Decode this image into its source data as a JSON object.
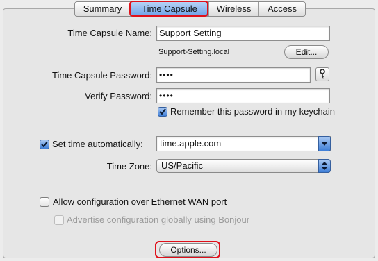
{
  "tabs": [
    {
      "label": "Summary",
      "active": false
    },
    {
      "label": "Time Capsule",
      "active": true
    },
    {
      "label": "Wireless",
      "active": false
    },
    {
      "label": "Access",
      "active": false
    }
  ],
  "form": {
    "name_label": "Time Capsule Name:",
    "name_value": "Support Setting",
    "local_hostname": "Support-Setting.local",
    "edit_button": "Edit...",
    "password_label": "Time Capsule Password:",
    "password_value": "••••",
    "verify_label": "Verify Password:",
    "verify_value": "••••",
    "remember_label": "Remember this password in my keychain",
    "remember_checked": true,
    "set_time_label": "Set time automatically:",
    "set_time_checked": true,
    "time_server_value": "time.apple.com",
    "time_zone_label": "Time Zone:",
    "time_zone_value": "US/Pacific",
    "allow_wan_label": "Allow configuration over Ethernet WAN port",
    "allow_wan_checked": false,
    "advertise_label": "Advertise configuration globally using Bonjour",
    "advertise_checked": false,
    "advertise_enabled": false,
    "options_button": "Options..."
  },
  "icons": {
    "key": "key-icon",
    "combo_arrow": "chevron-down-icon",
    "popup_arrows": "up-down-arrows-icon"
  },
  "colors": {
    "highlight_red": "#e0101a",
    "accent_blue": "#3f7fd8"
  }
}
